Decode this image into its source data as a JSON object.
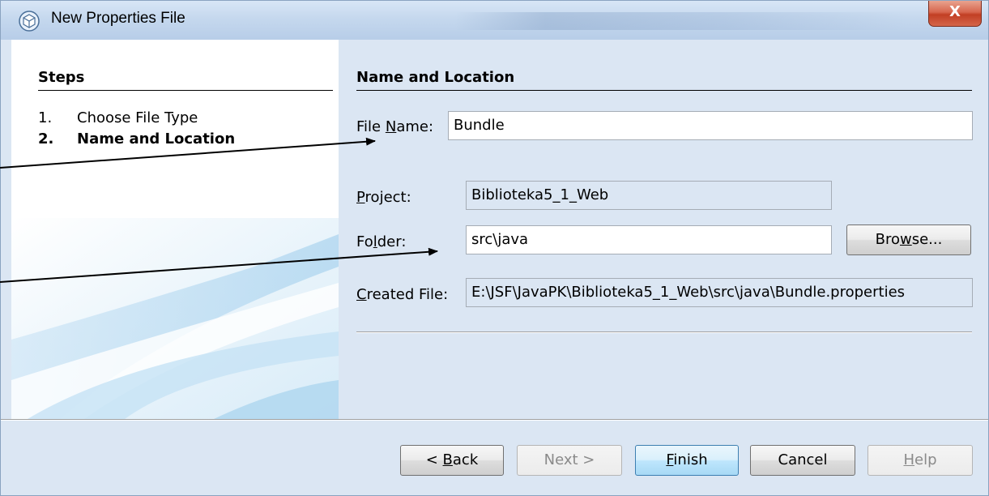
{
  "window": {
    "title": "New Properties File",
    "close_label": "X"
  },
  "steps": {
    "title": "Steps",
    "items": [
      {
        "num": "1.",
        "label": "Choose File Type"
      },
      {
        "num": "2.",
        "label": "Name and Location"
      }
    ]
  },
  "form": {
    "section_title": "Name and Location",
    "file_name": {
      "label_pre": "File ",
      "label_mn": "N",
      "label_post": "ame:",
      "value": "Bundle"
    },
    "project": {
      "label_mn": "P",
      "label_post": "roject:",
      "value": "Biblioteka5_1_Web"
    },
    "folder": {
      "label_pre": "Fo",
      "label_mn": "l",
      "label_post": "der:",
      "value": "src\\java"
    },
    "browse": {
      "pre": "Bro",
      "mn": "w",
      "post": "se..."
    },
    "created_file": {
      "label_mn": "C",
      "label_post": "reated File:",
      "value": "E:\\JSF\\JavaPK\\Biblioteka5_1_Web\\src\\java\\Bundle.properties"
    }
  },
  "buttons": {
    "back": {
      "pre": "< ",
      "mn": "B",
      "post": "ack"
    },
    "next": "Next >",
    "finish": {
      "mn": "F",
      "post": "inish"
    },
    "cancel": "Cancel",
    "help": {
      "mn": "H",
      "post": "elp"
    }
  },
  "colors": {
    "panel_bg": "#dbe6f3",
    "title_bar": "#c5d8ee",
    "close_button": "#c84a2e",
    "default_button_border": "#3c7fb1"
  }
}
